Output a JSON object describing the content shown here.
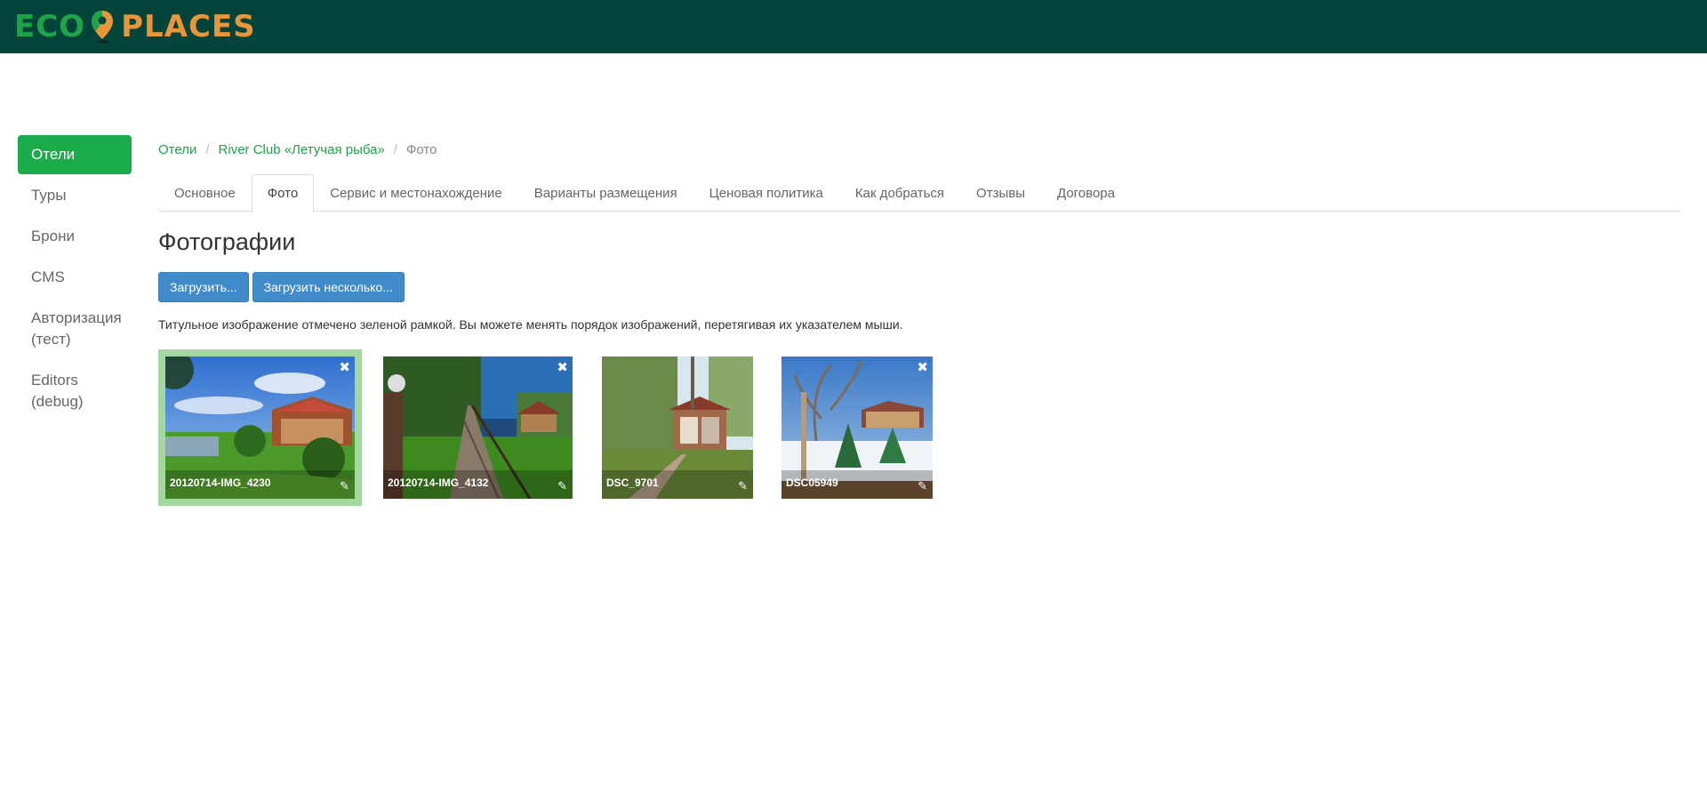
{
  "header": {
    "logo_left": "ECO",
    "logo_right": "PLACES",
    "brand_green": "#1fa34a",
    "brand_orange": "#e8963a",
    "bar_color": "#04443a"
  },
  "sidebar": {
    "items": [
      {
        "label": "Отели",
        "active": true
      },
      {
        "label": "Туры"
      },
      {
        "label": "Брони"
      },
      {
        "label": "CMS"
      },
      {
        "label": "Авторизация (тест)"
      },
      {
        "label": "Editors (debug)"
      }
    ]
  },
  "breadcrumb": {
    "items": [
      "Отели",
      "River Club «Летучая рыба»",
      "Фото"
    ],
    "separator": "/"
  },
  "tabs": [
    {
      "label": "Основное"
    },
    {
      "label": "Фото",
      "active": true
    },
    {
      "label": "Сервис и местонахождение"
    },
    {
      "label": "Варианты размещения"
    },
    {
      "label": "Ценовая политика"
    },
    {
      "label": "Как добраться"
    },
    {
      "label": "Отзывы"
    },
    {
      "label": "Договора"
    }
  ],
  "page": {
    "title": "Фотографии",
    "upload_label": "Загрузить...",
    "upload_multi_label": "Загрузить несколько...",
    "hint": "Титульное изображение отмечено зеленой рамкой. Вы можете менять порядок изображений, перетягивая их указателем мыши."
  },
  "photos": [
    {
      "name": "20120714-IMG_4230",
      "cover": true
    },
    {
      "name": "20120714-IMG_4132"
    },
    {
      "name": "DSC_9701"
    },
    {
      "name": "DSC05949"
    }
  ],
  "icons": {
    "delete": "close-icon",
    "edit": "pencil-icon"
  }
}
